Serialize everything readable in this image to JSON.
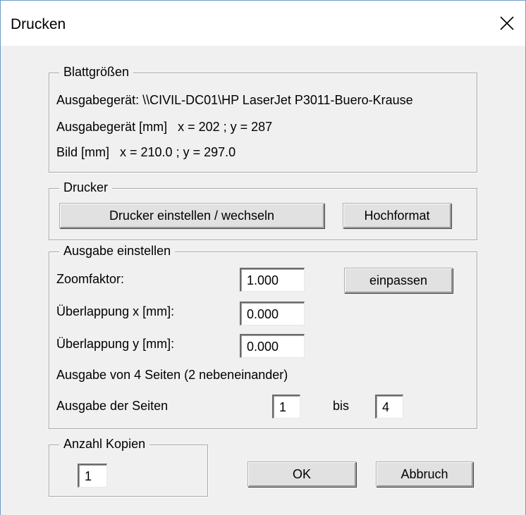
{
  "window": {
    "title": "Drucken"
  },
  "paper_sizes": {
    "legend": "Blattgrößen",
    "device_line": "Ausgabegerät: \\\\CIVIL-DC01\\HP LaserJet P3011-Buero-Krause",
    "device_mm_line": "Ausgabegerät [mm]   x = 202 ; y = 287",
    "image_mm_line": "Bild [mm]   x = 210.0 ; y = 297.0"
  },
  "printer": {
    "legend": "Drucker",
    "setup_button": "Drucker einstellen / wechseln",
    "orientation_button": "Hochformat"
  },
  "output": {
    "legend": "Ausgabe einstellen",
    "zoom_label": "Zoomfaktor:",
    "zoom_value": "1.000",
    "fit_button": "einpassen",
    "overlap_x_label": "Überlappung x [mm]:",
    "overlap_x_value": "0.000",
    "overlap_y_label": "Überlappung y [mm]:",
    "overlap_y_value": "0.000",
    "pages_info": "Ausgabe von 4 Seiten (2 nebeneinander)",
    "pages_label": "Ausgabe der Seiten",
    "from_value": "1",
    "to_label": "bis",
    "to_value": "4"
  },
  "copies": {
    "legend": "Anzahl Kopien",
    "value": "1"
  },
  "buttons": {
    "ok": "OK",
    "cancel": "Abbruch"
  }
}
